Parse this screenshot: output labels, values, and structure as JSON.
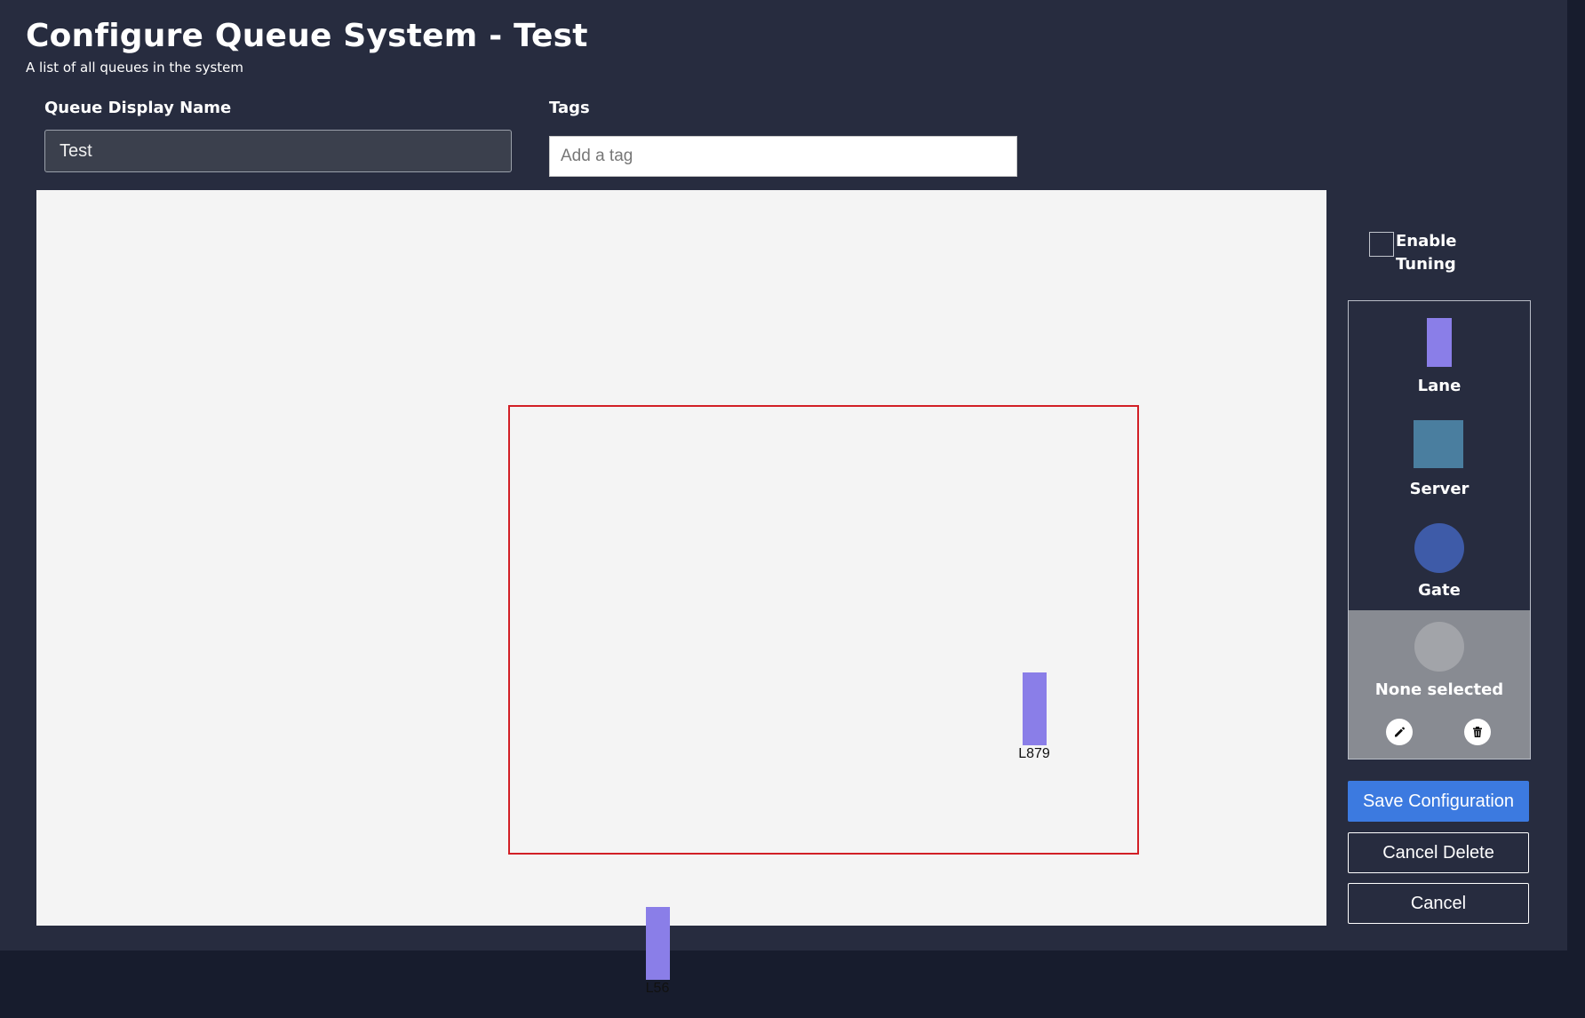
{
  "header": {
    "title": "Configure Queue System - Test",
    "subtitle": "A list of all queues in the system"
  },
  "form": {
    "name_label": "Queue Display Name",
    "name_value": "Test",
    "tags_label": "Tags",
    "tags_placeholder": "Add a tag"
  },
  "canvas": {
    "nodes": [
      {
        "type": "lane",
        "label": "L879"
      },
      {
        "type": "lane",
        "label": "L56"
      }
    ]
  },
  "tuning": {
    "label": "Enable Tuning",
    "checked": false
  },
  "palette": {
    "items": [
      {
        "label": "Lane",
        "color": "#8a7ee8",
        "icon": "lane-icon"
      },
      {
        "label": "Server",
        "color": "#4a7e9f",
        "icon": "server-icon"
      },
      {
        "label": "Gate",
        "color": "#3e5ba8",
        "icon": "gate-icon"
      }
    ],
    "selection_label": "None selected",
    "edit_icon": "pencil-icon",
    "delete_icon": "trash-icon"
  },
  "actions": {
    "save_label": "Save Configuration",
    "cancel_delete_label": "Cancel Delete",
    "cancel_label": "Cancel"
  },
  "colors": {
    "background": "#272c3f",
    "canvas": "#f4f4f4",
    "zone_border": "#d21f26",
    "primary": "#3c7ae0"
  }
}
